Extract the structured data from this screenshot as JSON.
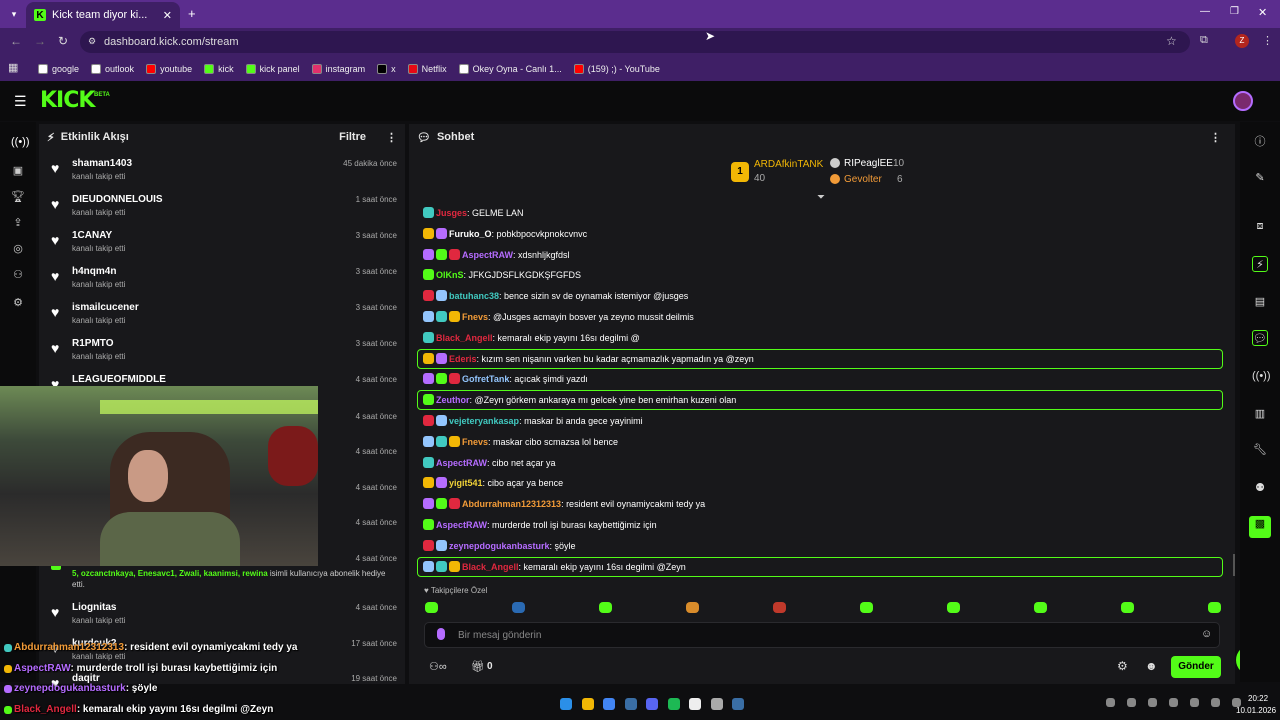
{
  "browser": {
    "tab_title": "Kick team diyor ki...",
    "url": "dashboard.kick.com/stream",
    "profile_letter": "Z"
  },
  "bookmarks": [
    {
      "label": "google",
      "color": "#ffffff"
    },
    {
      "label": "outlook",
      "color": "#ffffff"
    },
    {
      "label": "youtube",
      "color": "#ff0000"
    },
    {
      "label": "kick",
      "color": "#53fc18"
    },
    {
      "label": "kick panel",
      "color": "#53fc18"
    },
    {
      "label": "instagram",
      "color": "#e1306c"
    },
    {
      "label": "x",
      "color": "#000000"
    },
    {
      "label": "Netflix",
      "color": "#e50914"
    },
    {
      "label": "Okey Oyna - Canlı 1...",
      "color": "#ffffff"
    },
    {
      "label": "(159) ;) - YouTube",
      "color": "#ff0000"
    }
  ],
  "activity": {
    "title": "Etkinlik Akışı",
    "filter": "Filtre",
    "items": [
      {
        "name": "shaman1403",
        "sub": "kanalı takip etti",
        "time": "45 dakika önce"
      },
      {
        "name": "DIEUDONNELOUIS",
        "sub": "kanalı takip etti",
        "time": "1 saat önce"
      },
      {
        "name": "1CANAY",
        "sub": "kanalı takip etti",
        "time": "3 saat önce"
      },
      {
        "name": "h4nqm4n",
        "sub": "kanalı takip etti",
        "time": "3 saat önce"
      },
      {
        "name": "ismailcucener",
        "sub": "kanalı takip etti",
        "time": "3 saat önce"
      },
      {
        "name": "R1PMTO",
        "sub": "kanalı takip etti",
        "time": "3 saat önce"
      },
      {
        "name": "LEAGUEOFMIDDLE",
        "sub": "",
        "time": "4 saat önce"
      }
    ],
    "hidden_times": [
      "4 saat önce",
      "4 saat önce",
      "4 saat önce",
      "4 saat önce",
      "4 saat önce"
    ],
    "sub_gift_names": "5, ozcanctnkaya, Enesavc1, Zwali, kaanimsi, rewina",
    "sub_gift_text": " isimli kullanıcıya abonelik hediye etti.",
    "bottom_items": [
      {
        "name": "Liognitas",
        "sub": "kanalı takip etti",
        "time": "4 saat önce"
      },
      {
        "name": "kurdcuk2",
        "sub": "kanalı takip etti",
        "time": "17 saat önce"
      },
      {
        "name": "daqitr",
        "sub": "",
        "time": "19 saat önce"
      }
    ]
  },
  "chat": {
    "title": "Sohbet",
    "top_gifters": [
      {
        "name": "ARDAfkinTANK",
        "count": "40"
      },
      {
        "name": "RIPeaglEE",
        "count": "10"
      },
      {
        "name": "Gevolter",
        "count": "6"
      }
    ],
    "messages": [
      {
        "user": "Jusges",
        "color": "#e0283f",
        "text": ": GELME LAN",
        "hl": false
      },
      {
        "user": "Furuko_O",
        "color": "#ffffff",
        "text": ": pobkbpocvkpnokcvnvc",
        "hl": false
      },
      {
        "user": "AspectRAW",
        "color": "#b56cff",
        "text": ": xdsnhljkgfdsl",
        "hl": false
      },
      {
        "user": "OlKnS",
        "color": "#53fc18",
        "text": ": JFKGJDSFLKGDKŞFGFDS",
        "hl": false
      },
      {
        "user": "batuhanc38",
        "color": "#41c9c0",
        "text": ": bence sizin sv de oynamak istemiyor @jusges",
        "hl": false
      },
      {
        "user": "Fnevs",
        "color": "#f29b38",
        "text": ": @Jusges acmayin bosver ya zeyno mussit deilmis",
        "hl": false
      },
      {
        "user": "Black_Angell",
        "color": "#e0283f",
        "text": ": kemaralı ekip yayını 16sı degilmi @",
        "hl": false
      },
      {
        "user": "Ederis",
        "color": "#e0283f",
        "text": ": kızım sen nişanın varken bu kadar açmamazlık yapmadın ya @zeyn",
        "hl": true
      },
      {
        "user": "GofretTank",
        "color": "#93c5fd",
        "text": ": açıcak şimdi yazdı",
        "hl": false
      },
      {
        "user": "Zeuthor",
        "color": "#b56cff",
        "text": ": @Zeyn görkem ankaraya mı gelcek yine ben emirhan kuzeni olan",
        "hl": true
      },
      {
        "user": "vejeteryankasap",
        "color": "#41c9c0",
        "text": ": maskar bi anda gece yayinimi",
        "hl": false
      },
      {
        "user": "Fnevs",
        "color": "#f29b38",
        "text": ": maskar cibo scmazsa lol bence",
        "hl": false
      },
      {
        "user": "AspectRAW",
        "color": "#b56cff",
        "text": ": cibo net açar ya",
        "hl": false
      },
      {
        "user": "yigit541",
        "color": "#f2d338",
        "text": ": cibo açar ya bence",
        "hl": false
      },
      {
        "user": "Abdurrahman12312313",
        "color": "#f29b38",
        "text": ": resident evil oynamiycakmi tedy ya",
        "hl": false
      },
      {
        "user": "AspectRAW",
        "color": "#b56cff",
        "text": ": murderde troll işi burası kaybettiğimiz için",
        "hl": false
      },
      {
        "user": "zeynepdogukanbasturk",
        "color": "#b56cff",
        "text": ": şöyle",
        "hl": false
      },
      {
        "user": "Black_Angell",
        "color": "#e0283f",
        "text": ": kemaralı ekip yayını 16sı degilmi @Zeyn",
        "hl": true
      }
    ],
    "emote_tab": "Takipçilere Özel",
    "input_placeholder": "Bir mesaj gönderin",
    "send": "Gönder",
    "points": "0"
  },
  "overlay": [
    {
      "user": "Abdurrahman12312313",
      "color": "#f29b38",
      "text": ": resident evil oynamiycakmi tedy ya"
    },
    {
      "user": "AspectRAW",
      "color": "#b56cff",
      "text": ": murderde troll işi burası kaybettiğimiz için"
    },
    {
      "user": "zeynepdogukanbasturk",
      "color": "#b56cff",
      "text": ": şöyle"
    },
    {
      "user": "Black_Angell",
      "color": "#e0283f",
      "text": ": kemaralı ekip yayını 16sı degilmi @Zeyn"
    }
  ],
  "taskbar": {
    "time": "20:22",
    "date": "10.01.2026"
  },
  "colors": {
    "brand": "#53fc18",
    "browser": "#5b2d8e"
  }
}
